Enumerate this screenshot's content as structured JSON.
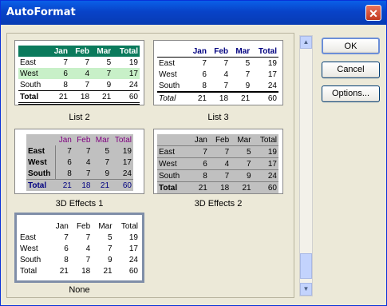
{
  "window": {
    "title": "AutoFormat"
  },
  "buttons": {
    "ok": "OK",
    "cancel": "Cancel",
    "options": "Options..."
  },
  "grid": {
    "headers": [
      "",
      "Jan",
      "Feb",
      "Mar",
      "Total"
    ],
    "rows": [
      [
        "East",
        "7",
        "7",
        "5",
        "19"
      ],
      [
        "West",
        "6",
        "4",
        "7",
        "17"
      ],
      [
        "South",
        "8",
        "7",
        "9",
        "24"
      ],
      [
        "Total",
        "21",
        "18",
        "21",
        "60"
      ]
    ]
  },
  "formats": [
    {
      "name": "List 2"
    },
    {
      "name": "List 3"
    },
    {
      "name": "3D Effects 1"
    },
    {
      "name": "3D Effects 2"
    },
    {
      "name": "None"
    }
  ],
  "colors": {
    "list2_header": "#0b7a5c",
    "list2_band": "#c8f0c8",
    "effects_gray": "#c0c0c0",
    "effects1_header": "#800080",
    "effects1_total": "#000080"
  }
}
